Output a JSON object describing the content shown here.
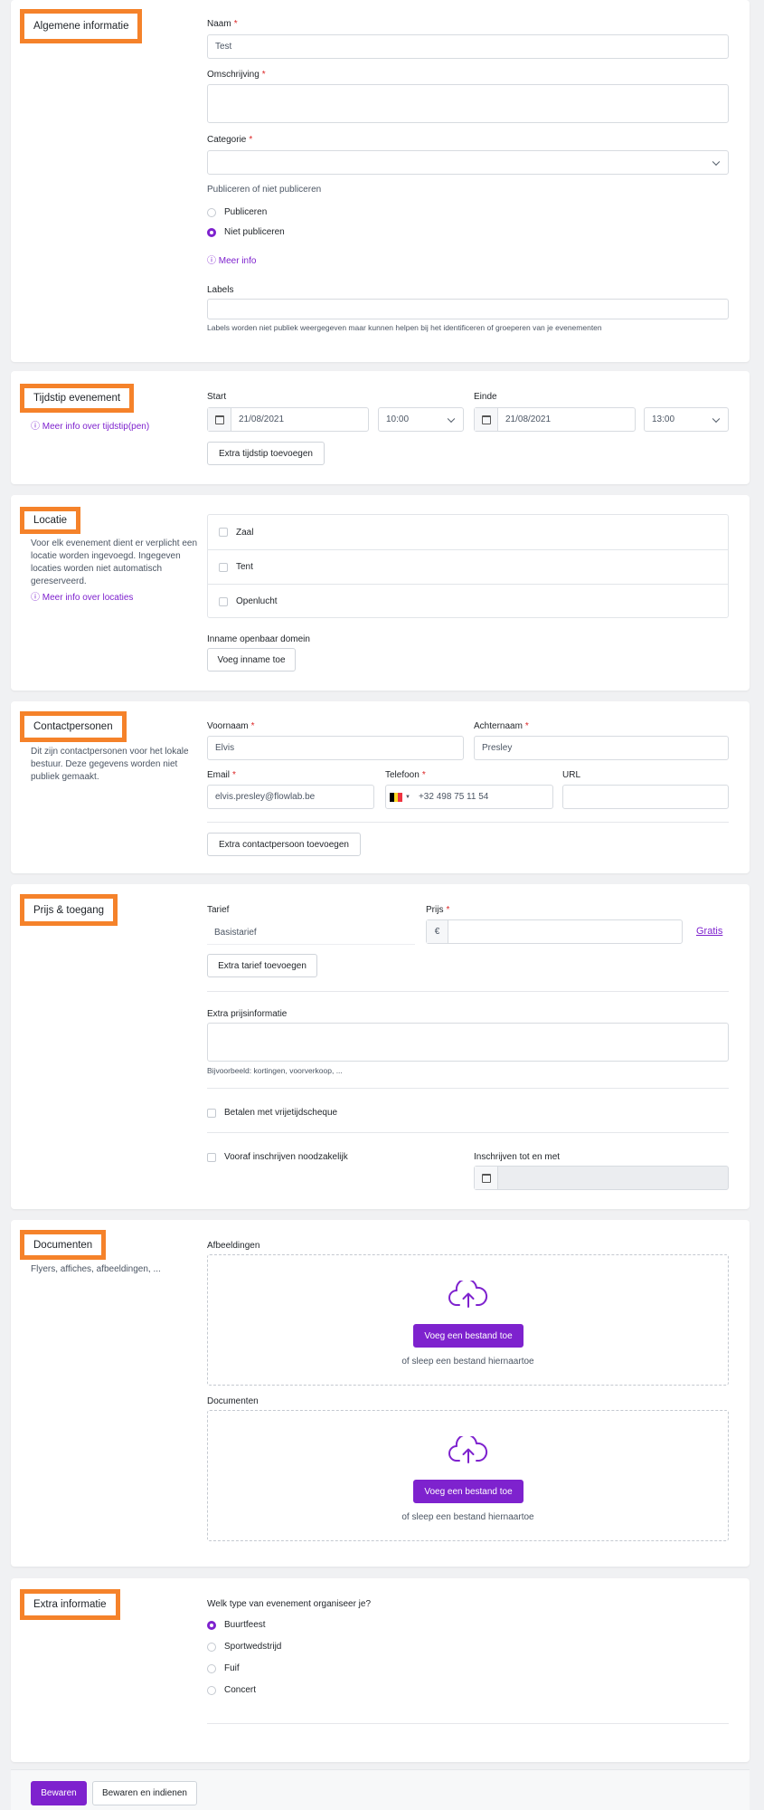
{
  "general": {
    "title": "Algemene informatie",
    "name_label": "Naam",
    "name_value": "Test",
    "description_label": "Omschrijving",
    "category_label": "Categorie",
    "publish_label": "Publiceren of niet publiceren",
    "publish_options": [
      "Publiceren",
      "Niet publiceren"
    ],
    "publish_selected": "Niet publiceren",
    "more_info": "ⓘ Meer info",
    "labels_label": "Labels",
    "labels_help": "Labels worden niet publiek weergegeven maar kunnen helpen bij het identificeren of groeperen van je evenementen"
  },
  "timing": {
    "title": "Tijdstip evenement",
    "more_info": "ⓘ Meer info over tijdstip(pen)",
    "start_label": "Start",
    "start_date": "21/08/2021",
    "start_time": "10:00",
    "end_label": "Einde",
    "end_date": "21/08/2021",
    "end_time": "13:00",
    "add_button": "Extra tijdstip toevoegen"
  },
  "location": {
    "title": "Locatie",
    "description": "Voor elk evenement dient er verplicht een locatie worden ingevoegd. Ingegeven locaties worden niet automatisch gereserveerd.",
    "more_info": "ⓘ Meer info over locaties",
    "options": [
      "Zaal",
      "Tent",
      "Openlucht"
    ],
    "public_domain_label": "Inname openbaar domein",
    "public_domain_button": "Voeg inname toe"
  },
  "contacts": {
    "title": "Contactpersonen",
    "description": "Dit zijn contactpersonen voor het lokale bestuur. Deze gegevens worden niet publiek gemaakt.",
    "firstname_label": "Voornaam",
    "firstname_value": "Elvis",
    "lastname_label": "Achternaam",
    "lastname_value": "Presley",
    "email_label": "Email",
    "email_value": "elvis.presley@flowlab.be",
    "phone_label": "Telefoon",
    "phone_value": "+32 498 75 11 54",
    "url_label": "URL",
    "add_button": "Extra contactpersoon toevoegen"
  },
  "pricing": {
    "title": "Prijs & toegang",
    "tariff_label": "Tarief",
    "tariff_value": "Basistarief",
    "price_label": "Prijs",
    "currency": "€",
    "free_link": "Gratis",
    "add_button": "Extra tarief toevoegen",
    "extra_label": "Extra prijsinformatie",
    "extra_help": "Bijvoorbeeld: kortingen, voorverkoop, ...",
    "voucher_label": "Betalen met vrijetijdscheque",
    "registration_label": "Vooraf inschrijven noodzakelijk",
    "registration_until_label": "Inschrijven tot en met"
  },
  "documents": {
    "title": "Documenten",
    "description": "Flyers, affiches, afbeeldingen, ...",
    "images_label": "Afbeeldingen",
    "docs_label": "Documenten",
    "upload_button": "Voeg een bestand toe",
    "drop_hint": "of sleep een bestand hiernaartoe"
  },
  "extra": {
    "title": "Extra informatie",
    "question": "Welk type van evenement organiseer je?",
    "options": [
      "Buurtfeest",
      "Sportwedstrijd",
      "Fuif",
      "Concert"
    ],
    "selected": "Buurtfeest"
  },
  "footer": {
    "save": "Bewaren",
    "save_submit": "Bewaren en indienen"
  },
  "colors": {
    "accent": "#7e22ce",
    "highlight_border": "#f5822a",
    "required": "#dc2626"
  }
}
